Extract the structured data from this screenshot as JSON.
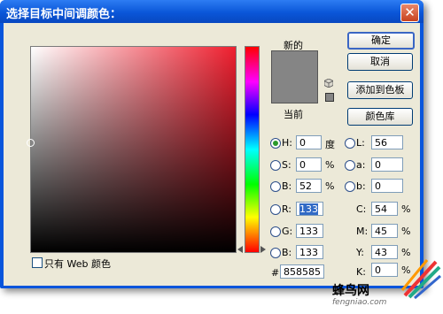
{
  "dialog": {
    "title": "选择目标中间调颜色："
  },
  "swatch": {
    "new_label": "新的",
    "current_label": "当前",
    "color": "#858585"
  },
  "buttons": {
    "ok": "确定",
    "cancel": "取消",
    "add_swatch": "添加到色板",
    "libraries": "颜色库"
  },
  "hsb": {
    "h": {
      "label": "H:",
      "value": "0",
      "unit": "度",
      "selected": true
    },
    "s": {
      "label": "S:",
      "value": "0",
      "unit": "%"
    },
    "b": {
      "label": "B:",
      "value": "52",
      "unit": "%"
    }
  },
  "lab": {
    "l": {
      "label": "L:",
      "value": "56"
    },
    "a": {
      "label": "a:",
      "value": "0"
    },
    "b": {
      "label": "b:",
      "value": "0"
    }
  },
  "rgb": {
    "r": {
      "label": "R:",
      "value": "133"
    },
    "g": {
      "label": "G:",
      "value": "133"
    },
    "b": {
      "label": "B:",
      "value": "133"
    }
  },
  "cmyk": {
    "c": {
      "label": "C:",
      "value": "54",
      "unit": "%"
    },
    "m": {
      "label": "M:",
      "value": "45",
      "unit": "%"
    },
    "y": {
      "label": "Y:",
      "value": "43",
      "unit": "%"
    },
    "k": {
      "label": "K:",
      "value": "0",
      "unit": "%"
    }
  },
  "hex": {
    "label": "#",
    "value": "858585"
  },
  "web_only": {
    "label": "只有 Web 颜色",
    "checked": false
  },
  "watermark": {
    "text": "蜂鸟网",
    "url": "fengniao.com"
  },
  "colors": {
    "title_bar": "#0a56d8",
    "client_bg": "#ece9d8",
    "field_hue": "#ef1f2f"
  }
}
